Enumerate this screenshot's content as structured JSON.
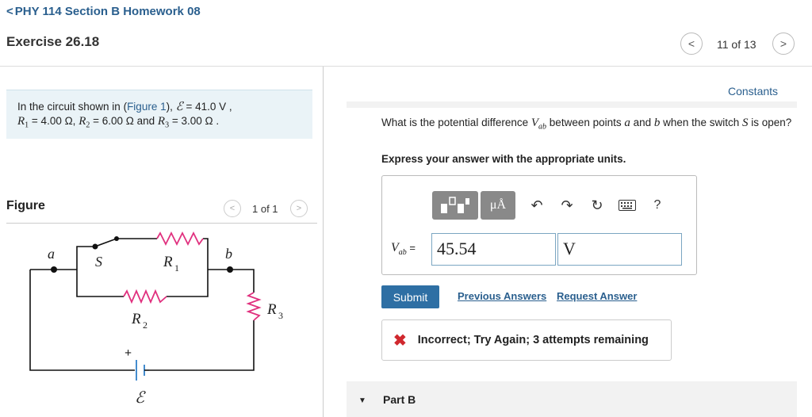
{
  "header": {
    "back_chevron": "<",
    "course_title": "PHY 114 Section B Homework 08",
    "exercise_title": "Exercise 26.18",
    "counter": "11 of 13",
    "prev_symbol": "<",
    "next_symbol": ">"
  },
  "problem": {
    "intro": "In the circuit shown in (",
    "figure_link": "Figure 1",
    "after_link": "), ",
    "emf_symbol": "ℰ",
    "emf_value": " = 41.0  V ,",
    "r1_symbol": "R",
    "r1_sub": "1",
    "r1_value": " = 4.00 Ω, ",
    "r2_symbol": "R",
    "r2_sub": "2",
    "r2_value": " = 6.00 Ω and ",
    "r3_symbol": "R",
    "r3_sub": "3",
    "r3_value": " = 3.00 Ω ."
  },
  "figure": {
    "title": "Figure",
    "counter": "1 of 1",
    "prev_symbol": "<",
    "next_symbol": ">",
    "labels": {
      "a": "a",
      "b": "b",
      "s": "S",
      "r1": "R",
      "r1_sub": "1",
      "r2": "R",
      "r2_sub": "2",
      "r3": "R",
      "r3_sub": "3",
      "emf": "ℰ",
      "plus": "+"
    },
    "resistor_color": "#e0307e",
    "battery_color": "#2f7fc8"
  },
  "right": {
    "constants_link": "Constants",
    "question_part1": "What is the potential difference ",
    "question_vab": "V",
    "question_vab_sub": "ab",
    "question_part2": " between points ",
    "question_a": "a",
    "question_and": " and ",
    "question_b": "b",
    "question_part3": " when the switch ",
    "question_s": "S",
    "question_part4": " is open?",
    "instruction": "Express your answer with the appropriate units.",
    "toolbar": {
      "units_label": "μÅ",
      "undo_symbol": "↶",
      "redo_symbol": "↷",
      "reset_symbol": "↻",
      "help_symbol": "?"
    },
    "answer_label": "V",
    "answer_label_sub": "ab",
    "answer_equals": " =",
    "value": "45.54",
    "unit": "V",
    "submit_label": "Submit",
    "previous_answers": "Previous Answers",
    "request_answer": "Request Answer",
    "feedback_icon": "✖",
    "feedback": "Incorrect; Try Again; 3 attempts remaining",
    "part_b_arrow": "▼",
    "part_b": "Part B"
  },
  "colors": {
    "link": "#2a5f8e",
    "submit_bg": "#2e6fa4",
    "error": "#d0282e",
    "problem_bg": "#eaf3f7"
  }
}
